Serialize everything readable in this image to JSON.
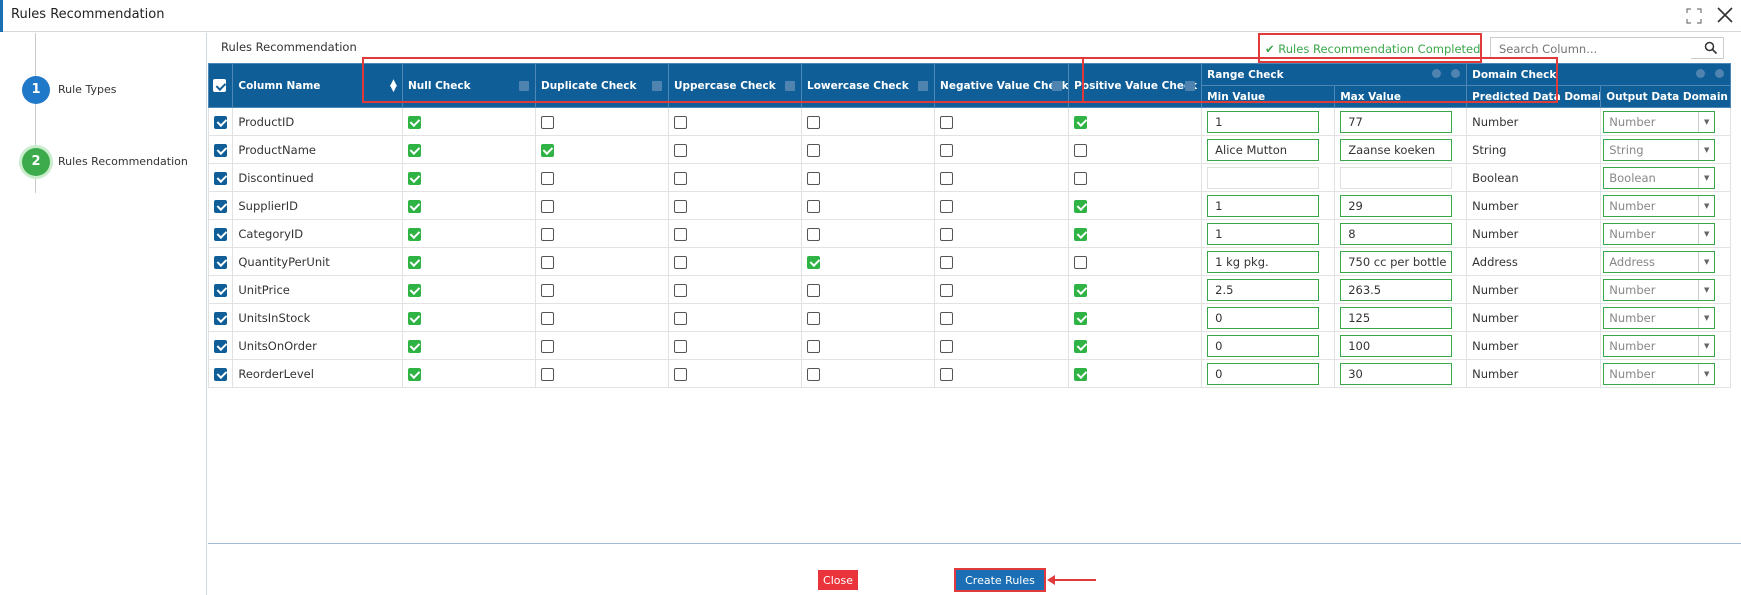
{
  "window": {
    "title": "Rules Recommendation"
  },
  "steps": [
    {
      "num": "1",
      "label": "Rule Types"
    },
    {
      "num": "2",
      "label": "Rules Recommendation"
    }
  ],
  "toolbar": {
    "title": "Rules Recommendation",
    "status": "Rules Recommendation Completed",
    "search_placeholder": "Search Column..."
  },
  "columns": {
    "name": "Column Name",
    "null": "Null Check",
    "duplicate": "Duplicate Check",
    "uppercase": "Uppercase Check",
    "lowercase": "Lowercase Check",
    "negative": "Negative Value Check",
    "positive": "Positive Value Check",
    "range": "Range Check",
    "min": "Min Value",
    "max": "Max Value",
    "domain": "Domain Check",
    "predicted": "Predicted Data Domain",
    "output": "Output Data Domain"
  },
  "rows": [
    {
      "name": "ProductID",
      "null": true,
      "dup": false,
      "upper": false,
      "lower": false,
      "neg": false,
      "pos": true,
      "min": "1",
      "max": "77",
      "pred": "Number",
      "out": "Number"
    },
    {
      "name": "ProductName",
      "null": true,
      "dup": true,
      "upper": false,
      "lower": false,
      "neg": false,
      "pos": false,
      "min": "Alice Mutton",
      "max": "Zaanse koeken",
      "pred": "String",
      "out": "String"
    },
    {
      "name": "Discontinued",
      "null": true,
      "dup": false,
      "upper": false,
      "lower": false,
      "neg": false,
      "pos": false,
      "min": "",
      "max": "",
      "pred": "Boolean",
      "out": "Boolean"
    },
    {
      "name": "SupplierID",
      "null": true,
      "dup": false,
      "upper": false,
      "lower": false,
      "neg": false,
      "pos": true,
      "min": "1",
      "max": "29",
      "pred": "Number",
      "out": "Number"
    },
    {
      "name": "CategoryID",
      "null": true,
      "dup": false,
      "upper": false,
      "lower": false,
      "neg": false,
      "pos": true,
      "min": "1",
      "max": "8",
      "pred": "Number",
      "out": "Number"
    },
    {
      "name": "QuantityPerUnit",
      "null": true,
      "dup": false,
      "upper": false,
      "lower": true,
      "neg": false,
      "pos": false,
      "min": "1 kg pkg.",
      "max": "750 cc per bottle",
      "pred": "Address",
      "out": "Address"
    },
    {
      "name": "UnitPrice",
      "null": true,
      "dup": false,
      "upper": false,
      "lower": false,
      "neg": false,
      "pos": true,
      "min": "2.5",
      "max": "263.5",
      "pred": "Number",
      "out": "Number"
    },
    {
      "name": "UnitsInStock",
      "null": true,
      "dup": false,
      "upper": false,
      "lower": false,
      "neg": false,
      "pos": true,
      "min": "0",
      "max": "125",
      "pred": "Number",
      "out": "Number"
    },
    {
      "name": "UnitsOnOrder",
      "null": true,
      "dup": false,
      "upper": false,
      "lower": false,
      "neg": false,
      "pos": true,
      "min": "0",
      "max": "100",
      "pred": "Number",
      "out": "Number"
    },
    {
      "name": "ReorderLevel",
      "null": true,
      "dup": false,
      "upper": false,
      "lower": false,
      "neg": false,
      "pos": true,
      "min": "0",
      "max": "30",
      "pred": "Number",
      "out": "Number"
    }
  ],
  "footer": {
    "close_label": "Close",
    "create_label": "Create Rules"
  },
  "colors": {
    "header": "#0f5e97",
    "check": "#2fb344",
    "highlight": "#e03a3a",
    "step1": "#1f78c8",
    "step2": "#3dab4c"
  }
}
